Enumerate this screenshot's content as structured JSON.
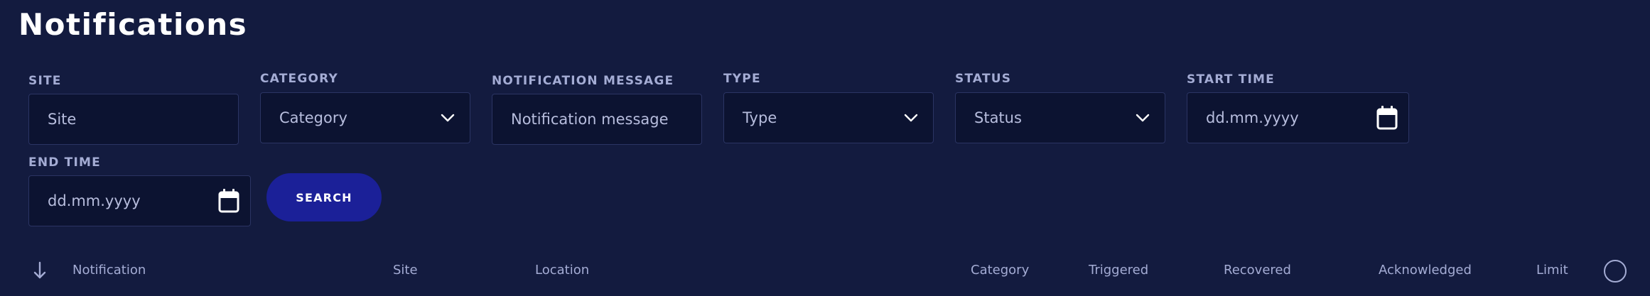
{
  "page": {
    "title": "Notifications"
  },
  "filters": {
    "site": {
      "label": "SITE",
      "placeholder": "Site"
    },
    "category": {
      "label": "CATEGORY",
      "value": "Category"
    },
    "message": {
      "label": "NOTIFICATION MESSAGE",
      "placeholder": "Notification message"
    },
    "type": {
      "label": "TYPE",
      "value": "Type"
    },
    "status": {
      "label": "STATUS",
      "value": "Status"
    },
    "start_time": {
      "label": "START TIME",
      "placeholder": "dd.mm.yyyy"
    },
    "end_time": {
      "label": "END TIME",
      "placeholder": "dd.mm.yyyy"
    },
    "search_label": "SEARCH"
  },
  "table": {
    "columns": [
      "Notification",
      "Site",
      "Location",
      "Category",
      "Triggered",
      "Recovered",
      "Acknowledged",
      "Limit"
    ],
    "sort_icon": "arrow-down-icon"
  },
  "colors": {
    "background": "#131b3f",
    "input_background": "#0c1331",
    "label": "#a4acd4",
    "button": "#1b2098"
  }
}
